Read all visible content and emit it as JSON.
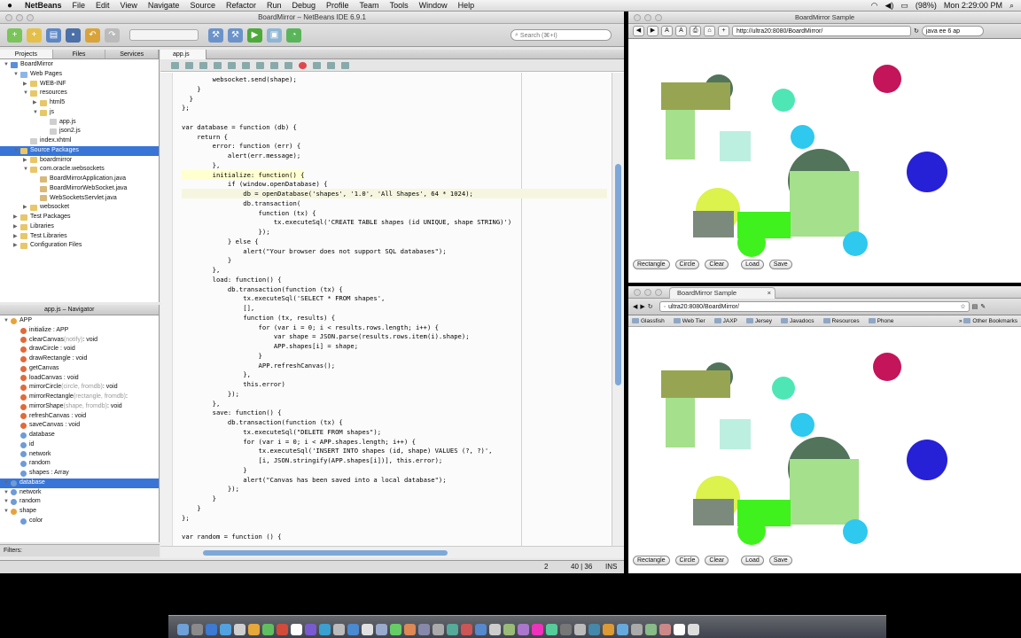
{
  "menubar": {
    "app": "NetBeans",
    "items": [
      "File",
      "Edit",
      "View",
      "Navigate",
      "Source",
      "Refactor",
      "Run",
      "Debug",
      "Profile",
      "Team",
      "Tools",
      "Window",
      "Help"
    ],
    "battery": "(98%)",
    "clock": "Mon 2:29:00 PM"
  },
  "ide": {
    "title": "BoardMirror – NetBeans IDE 6.9.1",
    "search_placeholder": "Search (⌘+I)",
    "panel_tabs": [
      "Projects",
      "Files",
      "Services"
    ],
    "tree": [
      {
        "label": "BoardMirror",
        "indent": 0,
        "color": "#5b8fd8",
        "tri": "▼"
      },
      {
        "label": "Web Pages",
        "indent": 1,
        "color": "#8fb5e6",
        "tri": "▼"
      },
      {
        "label": "WEB-INF",
        "indent": 2,
        "color": "#e7c768",
        "tri": "▶"
      },
      {
        "label": "resources",
        "indent": 2,
        "color": "#e7c768",
        "tri": "▼"
      },
      {
        "label": "html5",
        "indent": 3,
        "color": "#e7c768",
        "tri": "▶"
      },
      {
        "label": "js",
        "indent": 3,
        "color": "#e7c768",
        "tri": "▼"
      },
      {
        "label": "app.js",
        "indent": 4,
        "color": "#cfcfcf",
        "tri": ""
      },
      {
        "label": "json2.js",
        "indent": 4,
        "color": "#cfcfcf",
        "tri": ""
      },
      {
        "label": "index.xhtml",
        "indent": 2,
        "color": "#cfcfcf",
        "tri": ""
      },
      {
        "label": "Source Packages",
        "indent": 1,
        "color": "#e7c768",
        "tri": "▼",
        "selected": true
      },
      {
        "label": "boardmirror",
        "indent": 2,
        "color": "#e7c768",
        "tri": "▶"
      },
      {
        "label": "com.oracle.websockets",
        "indent": 2,
        "color": "#e7c768",
        "tri": "▼"
      },
      {
        "label": "BoardMirrorApplication.java",
        "indent": 3,
        "color": "#d9b97a",
        "tri": ""
      },
      {
        "label": "BoardMirrorWebSocket.java",
        "indent": 3,
        "color": "#d9b97a",
        "tri": ""
      },
      {
        "label": "WebSocketsServlet.java",
        "indent": 3,
        "color": "#d9b97a",
        "tri": ""
      },
      {
        "label": "websocket",
        "indent": 2,
        "color": "#e7c768",
        "tri": "▶"
      },
      {
        "label": "Test Packages",
        "indent": 1,
        "color": "#e7c768",
        "tri": "▶"
      },
      {
        "label": "Libraries",
        "indent": 1,
        "color": "#e7c768",
        "tri": "▶"
      },
      {
        "label": "Test Libraries",
        "indent": 1,
        "color": "#e7c768",
        "tri": "▶"
      },
      {
        "label": "Configuration Files",
        "indent": 1,
        "color": "#e7c768",
        "tri": "▶"
      }
    ],
    "navigator_title": "app.js – Navigator",
    "navigator": [
      {
        "label": "APP",
        "hint": "",
        "indent": 0,
        "color": "#e7a33b"
      },
      {
        "label": "initialize : APP",
        "hint": "",
        "indent": 1,
        "color": "#e06a3a"
      },
      {
        "label": "clearCanvas",
        "hint": "(notify)",
        "suffix": " : void",
        "indent": 1,
        "color": "#e06a3a"
      },
      {
        "label": "drawCircle : void",
        "hint": "",
        "indent": 1,
        "color": "#e06a3a"
      },
      {
        "label": "drawRectangle : void",
        "hint": "",
        "indent": 1,
        "color": "#e06a3a"
      },
      {
        "label": "getCanvas",
        "hint": "",
        "indent": 1,
        "color": "#e06a3a"
      },
      {
        "label": "loadCanvas : void",
        "hint": "",
        "indent": 1,
        "color": "#e06a3a"
      },
      {
        "label": "mirrorCircle",
        "hint": "(circle, fromdb)",
        "suffix": " : void",
        "indent": 1,
        "color": "#e06a3a"
      },
      {
        "label": "mirrorRectangle",
        "hint": "(rectangle, fromdb)",
        "suffix": " :",
        "indent": 1,
        "color": "#e06a3a"
      },
      {
        "label": "mirrorShape",
        "hint": "(shape, fromdb)",
        "suffix": " : void",
        "indent": 1,
        "color": "#e06a3a"
      },
      {
        "label": "refreshCanvas : void",
        "hint": "",
        "indent": 1,
        "color": "#e06a3a"
      },
      {
        "label": "saveCanvas : void",
        "hint": "",
        "indent": 1,
        "color": "#e06a3a"
      },
      {
        "label": "database",
        "hint": "",
        "indent": 1,
        "color": "#6f9bd6"
      },
      {
        "label": "id",
        "hint": "",
        "indent": 1,
        "color": "#6f9bd6"
      },
      {
        "label": "network",
        "hint": "",
        "indent": 1,
        "color": "#6f9bd6"
      },
      {
        "label": "random",
        "hint": "",
        "indent": 1,
        "color": "#6f9bd6"
      },
      {
        "label": "shapes : Array",
        "hint": "",
        "indent": 1,
        "color": "#6f9bd6"
      },
      {
        "label": "database",
        "hint": "",
        "indent": 0,
        "color": "#6f9bd6",
        "selected": true
      },
      {
        "label": "network",
        "hint": "",
        "indent": 0,
        "color": "#6f9bd6"
      },
      {
        "label": "random",
        "hint": "",
        "indent": 0,
        "color": "#6f9bd6"
      },
      {
        "label": "shape",
        "hint": "",
        "indent": 0,
        "color": "#e7a33b"
      },
      {
        "label": "color",
        "hint": "",
        "indent": 1,
        "color": "#6f9bd6"
      }
    ],
    "filters_label": "Filters:",
    "editor_tab": "app.js",
    "status_position": "40 | 36",
    "status_mode": "INS",
    "status_count": "2"
  },
  "code_lines": [
    "        websocket.send(shape);",
    "    }",
    "  }",
    "};",
    "",
    "var database = function (db) {",
    "    return {",
    "        error: function (err) {",
    "            alert(err.message);",
    "        },",
    "        initialize: function() {",
    "            if (window.openDatabase) {",
    "                db = openDatabase('shapes', '1.0', 'All Shapes', 64 * 1024);",
    "                db.transaction(",
    "                    function (tx) {",
    "                        tx.executeSql('CREATE TABLE shapes (id UNIQUE, shape STRING)')",
    "                    });",
    "            } else {",
    "                alert(\"Your browser does not support SQL databases\");",
    "            }",
    "        },",
    "        load: function() {",
    "            db.transaction(function (tx) {",
    "                tx.executeSql('SELECT * FROM shapes',",
    "                [],",
    "                function (tx, results) {",
    "                    for (var i = 0; i < results.rows.length; i++) {",
    "                        var shape = JSON.parse(results.rows.item(i).shape);",
    "                        APP.shapes[i] = shape;",
    "                    }",
    "                    APP.refreshCanvas();",
    "                },",
    "                this.error)",
    "            });",
    "        },",
    "        save: function() {",
    "            db.transaction(function (tx) {",
    "                tx.executeSql(\"DELETE FROM shapes\");",
    "                for (var i = 0; i < APP.shapes.length; i++) {",
    "                    tx.executeSql('INSERT INTO shapes (id, shape) VALUES (?, ?)',",
    "                    [i, JSON.stringify(APP.shapes[i])], this.error);",
    "                }",
    "                alert(\"Canvas has been saved into a local database\");",
    "            });",
    "        }",
    "    }",
    "};",
    "",
    "var random = function () {"
  ],
  "browser1": {
    "title": "BoardMirror Sample",
    "url": "http://ultra20:8080/BoardMirror/",
    "search": "java ee 6 ap"
  },
  "browser2": {
    "tab": "BoardMirror Sample",
    "url": "ultra20:8080/BoardMirror/",
    "bookmarks": [
      "Glassfish",
      "Web Tier",
      "JAXP",
      "Jersey",
      "Javadocs",
      "Resources",
      "Phone"
    ],
    "other_bookmarks": "Other Bookmarks"
  },
  "buttons": [
    "Rectangle",
    "Circle",
    "Clear",
    "Load",
    "Save"
  ],
  "shape_colors": {
    "olive": "#97a552",
    "darkgreen": "#52745a",
    "teal": "#4fe6b5",
    "cyan": "#2fc8ef",
    "magenta": "#c4145a",
    "blue": "#2620d6",
    "lightgreen": "#a5e08c",
    "paleteal": "#bdefe0",
    "yellow": "#dcf24d",
    "gray": "#7b8a7c",
    "green": "#3ff21d"
  }
}
